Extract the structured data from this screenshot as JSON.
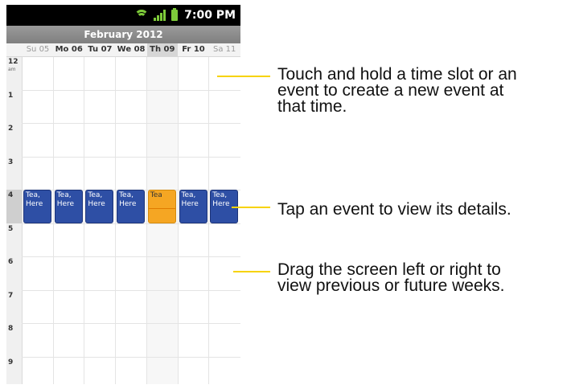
{
  "status_bar": {
    "time": "7:00 PM"
  },
  "calendar": {
    "month_title": "February 2012",
    "days": [
      {
        "label": "Su 05",
        "weekend": true,
        "today": false
      },
      {
        "label": "Mo 06",
        "weekend": false,
        "today": false
      },
      {
        "label": "Tu 07",
        "weekend": false,
        "today": false
      },
      {
        "label": "We 08",
        "weekend": false,
        "today": false
      },
      {
        "label": "Th 09",
        "weekend": false,
        "today": true
      },
      {
        "label": "Fr 10",
        "weekend": false,
        "today": false
      },
      {
        "label": "Sa 11",
        "weekend": true,
        "today": false
      }
    ],
    "hours": [
      {
        "label": "12",
        "sub": "am"
      },
      {
        "label": "1",
        "sub": ""
      },
      {
        "label": "2",
        "sub": ""
      },
      {
        "label": "3",
        "sub": ""
      },
      {
        "label": "4",
        "sub": ""
      },
      {
        "label": "5",
        "sub": ""
      },
      {
        "label": "6",
        "sub": ""
      },
      {
        "label": "7",
        "sub": ""
      },
      {
        "label": "8",
        "sub": ""
      },
      {
        "label": "9",
        "sub": ""
      }
    ],
    "events": [
      {
        "text": "Tea,\nHere",
        "today": false
      },
      {
        "text": "Tea,\nHere",
        "today": false
      },
      {
        "text": "Tea,\nHere",
        "today": false
      },
      {
        "text": "Tea,\nHere",
        "today": false
      },
      {
        "text": "Tea",
        "today": true
      },
      {
        "text": "Tea,\nHere",
        "today": false
      },
      {
        "text": "Tea,\nHere",
        "today": false
      }
    ]
  },
  "callouts": [
    {
      "text": "Touch and hold a time slot or an\nevent to create a new event at\nthat time."
    },
    {
      "text": "Tap an event to view its details."
    },
    {
      "text": "Drag the screen left or right to\nview previous or future weeks."
    }
  ],
  "colors": {
    "event_blue": "#2e4fa5",
    "event_today": "#f5a623",
    "callout_line": "#f7d300",
    "signal_green": "#7ecb3a"
  }
}
